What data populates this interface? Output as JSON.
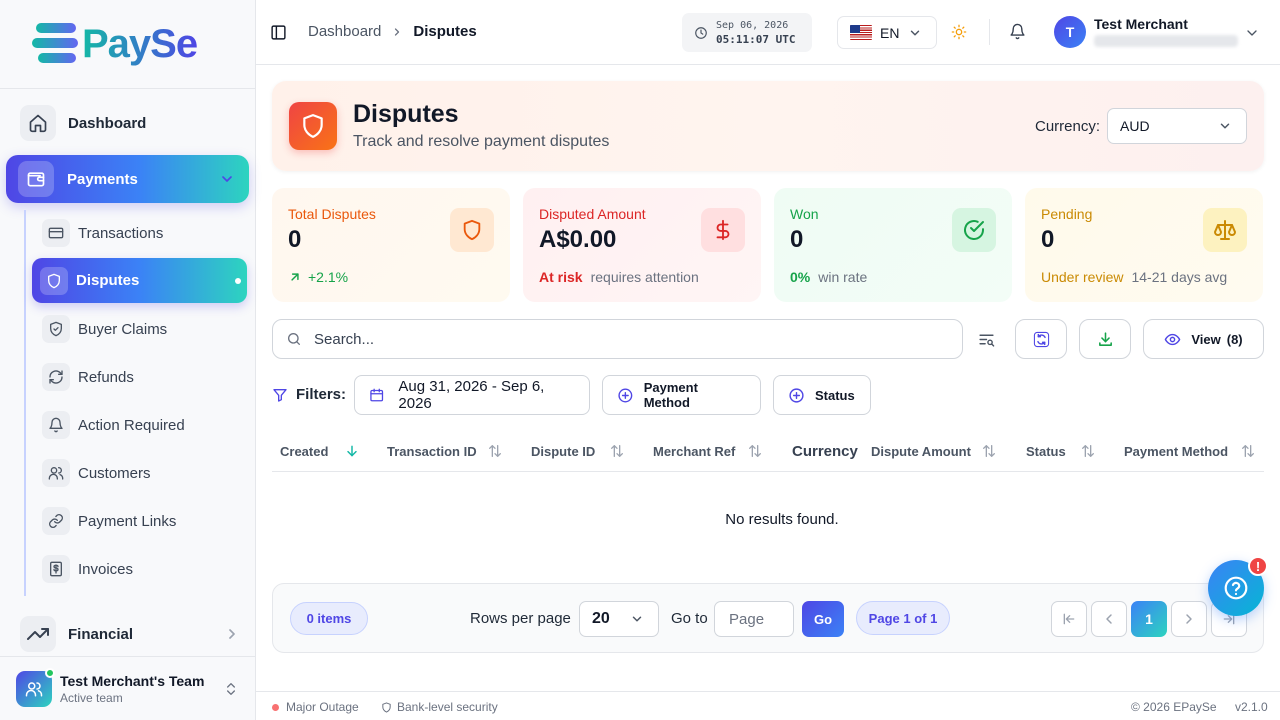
{
  "brand": {
    "name": "PaySe"
  },
  "sidebar": {
    "top_item": {
      "label": "Dashboard",
      "icon": "home-icon"
    },
    "payments": {
      "label": "Payments",
      "icon": "wallet-icon"
    },
    "sub_items": [
      {
        "label": "Transactions",
        "icon": "card-icon"
      },
      {
        "label": "Disputes",
        "icon": "shield-icon",
        "active": true
      },
      {
        "label": "Buyer Claims",
        "icon": "shield-check-icon"
      },
      {
        "label": "Refunds",
        "icon": "refresh-icon"
      },
      {
        "label": "Action Required",
        "icon": "bell-icon"
      },
      {
        "label": "Customers",
        "icon": "users-icon"
      },
      {
        "label": "Payment Links",
        "icon": "link-icon"
      },
      {
        "label": "Invoices",
        "icon": "dollar-file-icon"
      }
    ],
    "financial": {
      "label": "Financial",
      "icon": "trend-icon"
    },
    "team": {
      "name": "Test Merchant's Team",
      "status": "Active team"
    }
  },
  "header": {
    "breadcrumb": [
      "Dashboard",
      "Disputes"
    ],
    "clock": {
      "date": "Sep 06, 2026",
      "time": "05:11:07 UTC"
    },
    "language": "EN",
    "user": {
      "initial": "T",
      "name": "Test Merchant"
    }
  },
  "page": {
    "title": "Disputes",
    "subtitle": "Track and resolve payment disputes",
    "currency_label": "Currency:",
    "currency_value": "AUD"
  },
  "stats": [
    {
      "label": "Total Disputes",
      "value": "0",
      "foot_strong": "+2.1%",
      "foot_muted": "",
      "color": "#ea580c",
      "icon": "shield-icon"
    },
    {
      "label": "Disputed Amount",
      "value": "A$0.00",
      "foot_strong": "At risk",
      "foot_muted": "requires attention",
      "color": "#dc2626",
      "icon": "dollar-icon"
    },
    {
      "label": "Won",
      "value": "0",
      "foot_strong": "0%",
      "foot_muted": "win rate",
      "color": "#16a34a",
      "icon": "check-circle-icon"
    },
    {
      "label": "Pending",
      "value": "0",
      "foot_strong": "Under review",
      "foot_muted": "14-21 days avg",
      "color": "#ca8a04",
      "icon": "scale-icon"
    }
  ],
  "toolbar": {
    "search_placeholder": "Search...",
    "view_label": "View",
    "view_count": "(8)"
  },
  "filters": {
    "label": "Filters:",
    "date_range": "Aug 31, 2026 - Sep 6, 2026",
    "payment_method": "Payment Method",
    "status": "Status"
  },
  "table": {
    "columns": [
      "Created",
      "Transaction ID",
      "Dispute ID",
      "Merchant Ref",
      "Currency",
      "Dispute Amount",
      "Status",
      "Payment Method"
    ],
    "empty_text": "No results found."
  },
  "pagination": {
    "items": "0 items",
    "rows_per_page_label": "Rows per page",
    "rows_per_page": "20",
    "goto_label": "Go to",
    "page_placeholder": "Page",
    "go": "Go",
    "page_of": "Page 1 of 1",
    "current_page": "1"
  },
  "help_badge": "!",
  "footer": {
    "status": "Major Outage",
    "security": "Bank-level security",
    "copyright": "© 2026 EPaySe",
    "version": "v2.1.0"
  },
  "colors": {
    "accent": "#4f46e5",
    "accent_teal": "#2dd4bf",
    "outage": "#f87171"
  }
}
